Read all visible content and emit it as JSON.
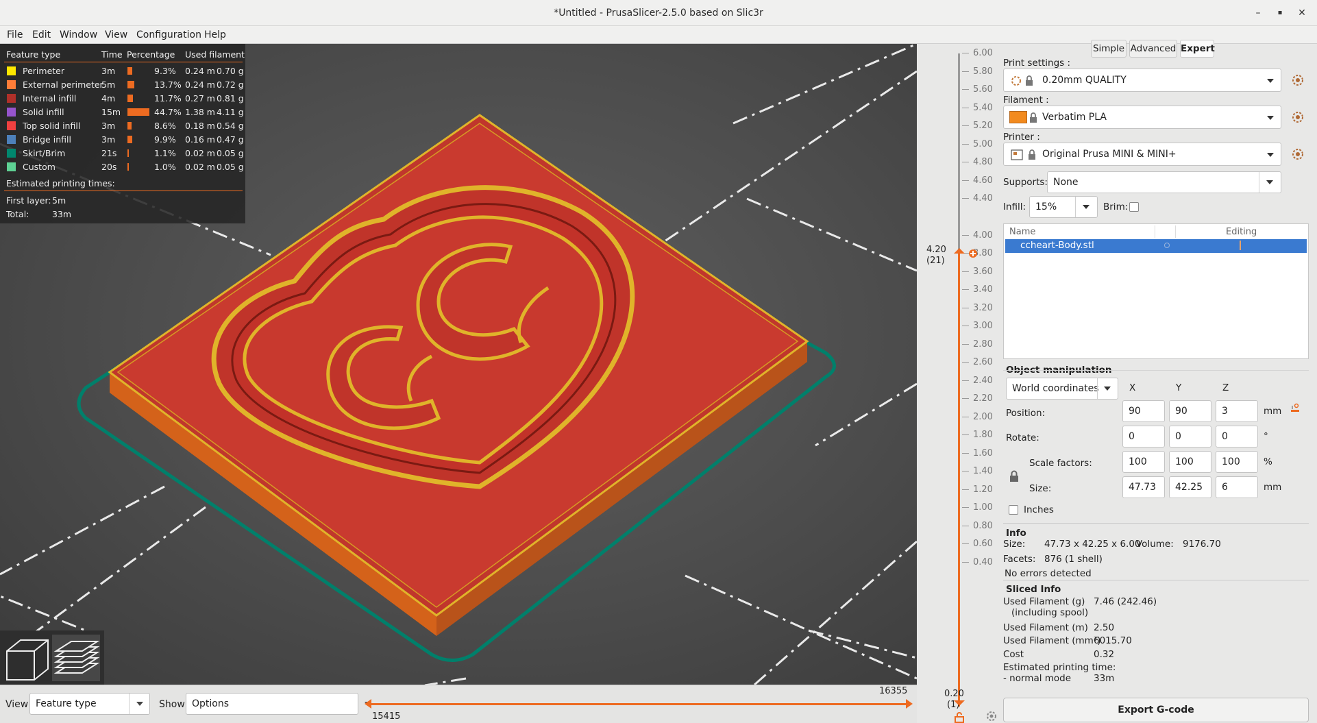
{
  "window": {
    "title": "*Untitled - PrusaSlicer-2.5.0 based on Slic3r",
    "minimize": "–",
    "maximize": "▪",
    "close": "✕"
  },
  "menu": [
    "File",
    "Edit",
    "Window",
    "View",
    "Configuration",
    "Help"
  ],
  "legend": {
    "headers": [
      "Feature type",
      "Time",
      "Percentage",
      "Used filament"
    ],
    "rows": [
      {
        "name": "Perimeter",
        "time": "3m",
        "pct": "9.3%",
        "len": "0.24 m",
        "weight": "0.70 g",
        "color": "#ffe800",
        "fraction": 0.093
      },
      {
        "name": "External perimeter",
        "time": "5m",
        "pct": "13.7%",
        "len": "0.24 m",
        "weight": "0.72 g",
        "color": "#ff7d38",
        "fraction": 0.137
      },
      {
        "name": "Internal infill",
        "time": "4m",
        "pct": "11.7%",
        "len": "0.27 m",
        "weight": "0.81 g",
        "color": "#b03029",
        "fraction": 0.117
      },
      {
        "name": "Solid infill",
        "time": "15m",
        "pct": "44.7%",
        "len": "1.38 m",
        "weight": "4.11 g",
        "color": "#9654cc",
        "fraction": 0.447
      },
      {
        "name": "Top solid infill",
        "time": "3m",
        "pct": "8.6%",
        "len": "0.18 m",
        "weight": "0.54 g",
        "color": "#f04040",
        "fraction": 0.086
      },
      {
        "name": "Bridge infill",
        "time": "3m",
        "pct": "9.9%",
        "len": "0.16 m",
        "weight": "0.47 g",
        "color": "#4d80ba",
        "fraction": 0.099
      },
      {
        "name": "Skirt/Brim",
        "time": "21s",
        "pct": "1.1%",
        "len": "0.02 m",
        "weight": "0.05 g",
        "color": "#00876e",
        "fraction": 0.011
      },
      {
        "name": "Custom",
        "time": "20s",
        "pct": "1.0%",
        "len": "0.02 m",
        "weight": "0.05 g",
        "color": "#5ed194",
        "fraction": 0.01
      }
    ],
    "estimated_label": "Estimated printing times:",
    "first_layer_label": "First layer:",
    "first_layer_value": "5m",
    "total_label": "Total:",
    "total_value": "33m"
  },
  "bottom": {
    "view_label": "View",
    "view_value": "Feature type",
    "show_label": "Show",
    "show_value": "Options",
    "slider_upper": "16355",
    "slider_lower": "15415"
  },
  "vslider": {
    "ticks": [
      "6.00",
      "5.80",
      "5.60",
      "5.40",
      "5.20",
      "5.00",
      "4.80",
      "4.60",
      "4.40",
      "4.00",
      "3.80",
      "3.60",
      "3.40",
      "3.20",
      "3.00",
      "2.80",
      "2.60",
      "2.40",
      "2.20",
      "2.00",
      "1.80",
      "1.60",
      "1.40",
      "1.20",
      "1.00",
      "0.80",
      "0.60",
      "0.40"
    ],
    "current_value": "4.20",
    "current_layer": "(21)",
    "bottom_value": "0.20",
    "bottom_layer": "(1)"
  },
  "panel": {
    "modes": [
      "Simple",
      "Advanced",
      "Expert"
    ],
    "print_settings_label": "Print settings :",
    "print_settings_value": "0.20mm QUALITY",
    "filament_label": "Filament :",
    "filament_value": "Verbatim PLA",
    "filament_color": "#f28a1e",
    "printer_label": "Printer :",
    "printer_value": "Original Prusa MINI & MINI+",
    "supports_label": "Supports:",
    "supports_value": "None",
    "infill_label": "Infill:",
    "infill_value": "15%",
    "brim_label": "Brim:",
    "list_headers": [
      "Name",
      "Editing"
    ],
    "object_name": "ccheart-Body.stl",
    "objman_title": "Object manipulation",
    "coords_value": "World coordinates",
    "axes": [
      "X",
      "Y",
      "Z"
    ],
    "position_label": "Position:",
    "position": [
      "90",
      "90",
      "3"
    ],
    "position_unit": "mm",
    "rotate_label": "Rotate:",
    "rotate": [
      "0",
      "0",
      "0"
    ],
    "rotate_unit": "°",
    "scale_label": "Scale factors:",
    "scale": [
      "100",
      "100",
      "100"
    ],
    "scale_unit": "%",
    "size_label": "Size:",
    "size": [
      "47.73",
      "42.25",
      "6"
    ],
    "size_unit": "mm",
    "inches_label": "Inches",
    "info_title": "Info",
    "info_size_label": "Size:",
    "info_size_value": "47.73 x 42.25 x 6.00",
    "info_volume_label": "Volume:",
    "info_volume_value": "9176.70",
    "info_facets_label": "Facets:",
    "info_facets_value": "876 (1 shell)",
    "info_errors": "No errors detected",
    "sliced_title": "Sliced Info",
    "sliced": [
      {
        "label": "Used Filament (g)",
        "value": "7.46 (242.46)"
      },
      {
        "label": "(including spool)",
        "value": ""
      },
      {
        "label": "Used Filament (m)",
        "value": "2.50"
      },
      {
        "label": "Used Filament (mm³)",
        "value": "6015.70"
      },
      {
        "label": "Cost",
        "value": "0.32"
      },
      {
        "label": "Estimated printing time:",
        "value": ""
      },
      {
        "label": " - normal mode",
        "value": "33m"
      }
    ],
    "export_label": "Export G-code"
  }
}
